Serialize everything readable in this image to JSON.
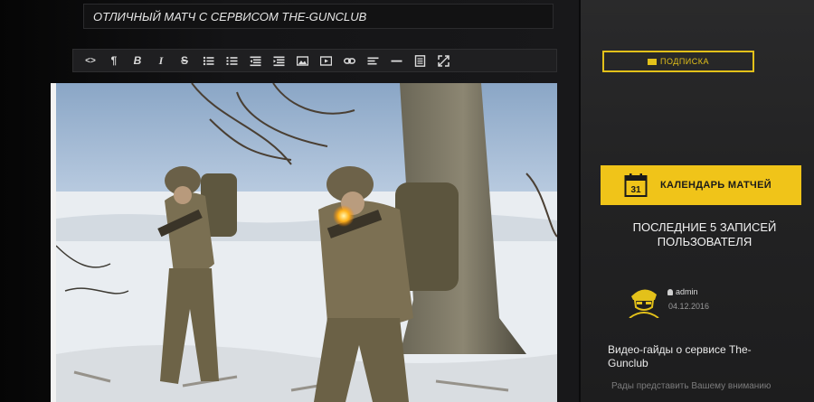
{
  "editor": {
    "title_value": "ОТЛИЧНЫЙ МАТЧ С СЕРВИСОМ THE-GUNCLUB",
    "toolbar": [
      {
        "name": "html-code-button",
        "icon": "code-icon",
        "glyph": "<>"
      },
      {
        "name": "paragraph-button",
        "icon": "paragraph-icon",
        "glyph": "¶"
      },
      {
        "name": "bold-button",
        "icon": "bold-icon",
        "glyph": "B"
      },
      {
        "name": "italic-button",
        "icon": "italic-icon",
        "glyph": "I"
      },
      {
        "name": "strikethrough-button",
        "icon": "strikethrough-icon",
        "glyph": "S"
      },
      {
        "name": "unordered-list-button",
        "icon": "bullet-list-icon",
        "glyph": ""
      },
      {
        "name": "ordered-list-button",
        "icon": "numbered-list-icon",
        "glyph": ""
      },
      {
        "name": "outdent-button",
        "icon": "outdent-icon",
        "glyph": ""
      },
      {
        "name": "indent-button",
        "icon": "indent-icon",
        "glyph": ""
      },
      {
        "name": "insert-image-button",
        "icon": "image-icon",
        "glyph": ""
      },
      {
        "name": "insert-video-button",
        "icon": "video-icon",
        "glyph": ""
      },
      {
        "name": "insert-link-button",
        "icon": "link-icon",
        "glyph": ""
      },
      {
        "name": "align-button",
        "icon": "align-left-icon",
        "glyph": ""
      },
      {
        "name": "horizontal-rule-button",
        "icon": "horizontal-rule-icon",
        "glyph": ""
      },
      {
        "name": "source-button",
        "icon": "document-icon",
        "glyph": ""
      },
      {
        "name": "fullscreen-button",
        "icon": "expand-icon",
        "glyph": ""
      }
    ]
  },
  "sidebar": {
    "subscribe_label": "ПОДПИСКА",
    "calendar_day": "31",
    "calendar_label": "КАЛЕНДАРЬ МАТЧЕЙ",
    "recent_title": "ПОСЛЕДНИЕ 5 ЗАПИСЕЙ ПОЛЬЗОВАТЕЛЯ",
    "post": {
      "author": "admin",
      "date": "04.12.2016",
      "title": "Видео-гайды о сервисе The-Gunclub",
      "excerpt": "Рады представить Вашему вниманию"
    }
  },
  "colors": {
    "accent": "#f0c419",
    "sidebar_bg": "#242425",
    "editor_bg": "#141416"
  }
}
